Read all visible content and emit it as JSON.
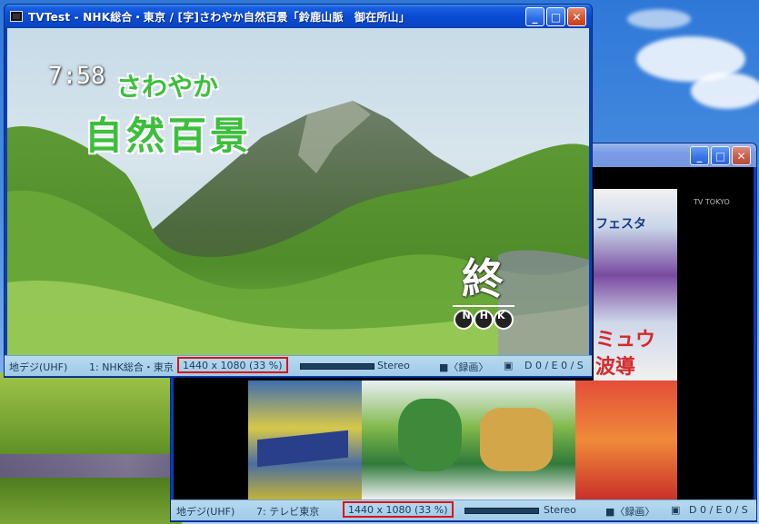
{
  "window_main": {
    "title": "TVTest - NHK総合・東京 / [字]さわやか自然百景「鈴鹿山脈　御在所山」",
    "buttons": {
      "minimize": "_",
      "maximize": "□",
      "close": "✕"
    },
    "video": {
      "clock": "7:58",
      "program_line1": "さわやか",
      "program_line2": "自然百景",
      "end_mark": "終",
      "logo_text": "NHK"
    },
    "status": {
      "tuner": "地デジ(UHF)",
      "channel": "1: NHK総合・東京",
      "resolution": "1440 x 1080 (33 %)",
      "audio": "Stereo",
      "record": "■〈録画〉",
      "counters": "D 0 / E 0 / S"
    }
  },
  "window_second": {
    "buttons": {
      "minimize": "_",
      "maximize": "□",
      "close": "✕"
    },
    "video": {
      "watermark": "TV TOKYO",
      "poster_text_1": "フェスタ",
      "poster_text_2": "ミュウ",
      "poster_text_3": "波導"
    },
    "status": {
      "tuner": "地デジ(UHF)",
      "channel": "7: テレビ東京",
      "resolution": "1440 x 1080 (33 %)",
      "audio": "Stereo",
      "record": "■〈録画〉",
      "counters": "D 0 / E 0 / S"
    }
  },
  "colors": {
    "highlight_box": "#e01010",
    "titlebar_active": "#0a47c8",
    "statusbar": "#a8d2ec",
    "caption_green": "#3cbf3c"
  },
  "icons": [
    "tvtest-app-icon",
    "minimize-icon",
    "maximize-icon",
    "close-icon",
    "capture-camera-icon"
  ]
}
